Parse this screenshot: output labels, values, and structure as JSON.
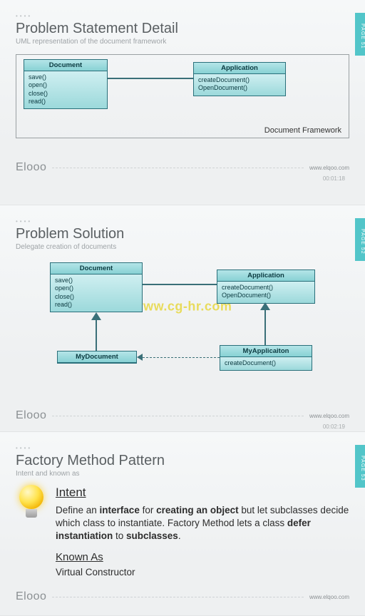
{
  "slides": [
    {
      "tab": "PAGE 51",
      "title": "Problem Statement Detail",
      "subtitle": "UML representation of the document framework",
      "frame_label": "Document Framework",
      "uml": {
        "document": {
          "name": "Document",
          "methods": [
            "save()",
            "open()",
            "close()",
            "read()"
          ]
        },
        "application": {
          "name": "Application",
          "methods": [
            "createDocument()",
            "OpenDocument()"
          ]
        }
      },
      "brand": "Elooo",
      "url": "www.elqoo.com",
      "timestamp": "00:01:18"
    },
    {
      "tab": "PAGE 52",
      "title": "Problem Solution",
      "subtitle": "Delegate creation of documents",
      "uml": {
        "document": {
          "name": "Document",
          "methods": [
            "save()",
            "open()",
            "close()",
            "read()"
          ]
        },
        "application": {
          "name": "Application",
          "methods": [
            "createDocument()",
            "OpenDocument()"
          ]
        },
        "my_document": {
          "name": "MyDocument"
        },
        "my_application": {
          "name": "MyApplicaiton",
          "methods": [
            "createDocument()"
          ]
        }
      },
      "watermark": "www.cg-hr.com",
      "brand": "Elooo",
      "url": "www.elqoo.com",
      "timestamp": "00:02:19"
    },
    {
      "tab": "PAGE 53",
      "title": "Factory Method Pattern",
      "subtitle": "Intent and known as",
      "intent_heading": "Intent",
      "intent_pre": "Define an ",
      "intent_b1": "interface",
      "intent_mid1": " for ",
      "intent_b2": "creating an object",
      "intent_mid2": " but let subclasses decide which class to instantiate. Factory Method lets a class ",
      "intent_b3": "defer instantiation",
      "intent_mid3": " to ",
      "intent_b4": "subclasses",
      "intent_post": ".",
      "known_heading": "Known As",
      "known_text": "Virtual Constructor",
      "brand": "Elooo",
      "url": "www.elqoo.com"
    }
  ]
}
